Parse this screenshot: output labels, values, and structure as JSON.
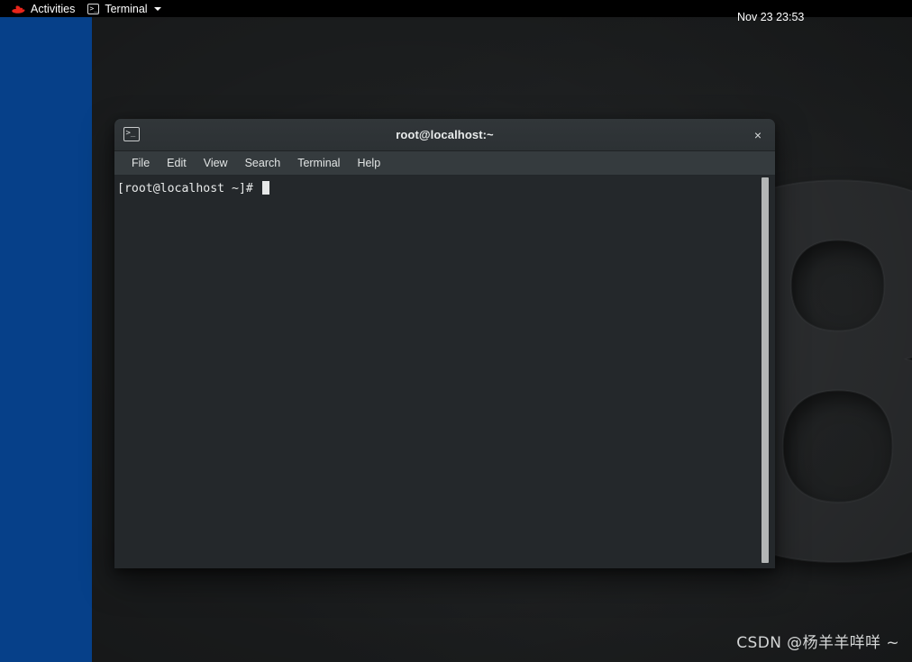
{
  "topbar": {
    "activities_label": "Activities",
    "activities_icon": "redhat-logo-icon",
    "app_menu_label": "Terminal",
    "app_menu_icon": "terminal-icon",
    "app_menu_caret": "chevron-down-icon",
    "clock": "Nov 23  23:53",
    "background_color": "#000000"
  },
  "desktop": {
    "blue_panel_color": "#064089",
    "wallpaper_glyph": "8",
    "wallpaper_color": "#1e2021"
  },
  "terminal_window": {
    "title": "root@localhost:~",
    "title_icon": "terminal-icon",
    "close_label": "×",
    "titlebar_color": "#2e3436",
    "body_color": "#24282b",
    "menu": [
      {
        "label": "File"
      },
      {
        "label": "Edit"
      },
      {
        "label": "View"
      },
      {
        "label": "Search"
      },
      {
        "label": "Terminal"
      },
      {
        "label": "Help"
      }
    ],
    "content": {
      "prompt": "[root@localhost ~]# "
    },
    "scrollbar": {
      "thumb_color": "#b3b6b6"
    }
  },
  "watermark": {
    "text": "CSDN @杨羊羊咩咩 ~"
  }
}
